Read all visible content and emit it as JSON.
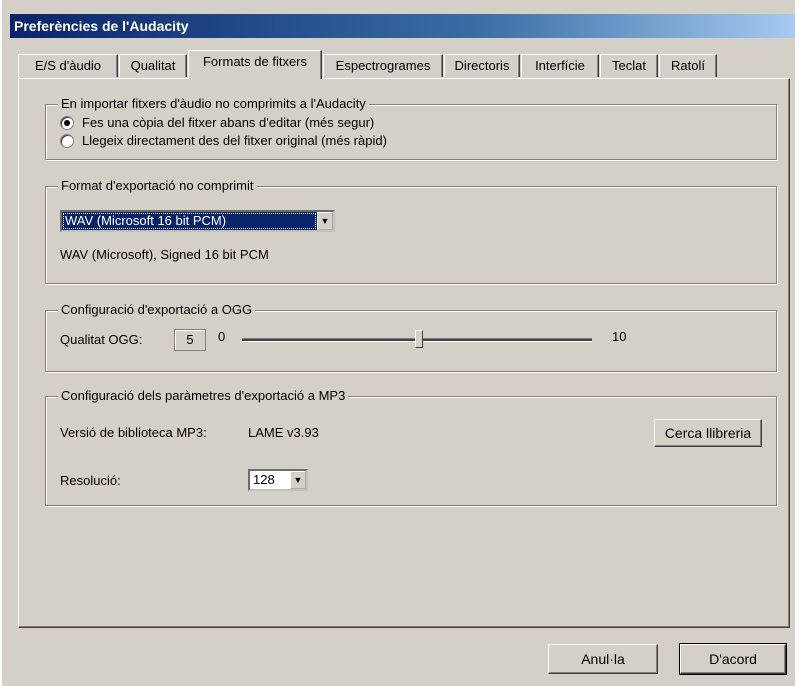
{
  "window": {
    "title": "Preferències de l'Audacity"
  },
  "tabs": [
    {
      "label": "E/S d'àudio"
    },
    {
      "label": "Qualitat"
    },
    {
      "label": "Formats de fitxers"
    },
    {
      "label": "Espectrogrames"
    },
    {
      "label": "Directoris"
    },
    {
      "label": "Interfície"
    },
    {
      "label": "Teclat"
    },
    {
      "label": "Ratolí"
    }
  ],
  "import_group": {
    "legend": "En importar fitxers d'àudio no comprimits a l'Audacity",
    "option_copy": "Fes una còpia del fitxer abans d'editar (més segur)",
    "option_direct": "Llegeix directament des del fitxer original (més ràpid)",
    "selected": "copy"
  },
  "export_group": {
    "legend": "Format d'exportació no comprimit",
    "format_value": "WAV (Microsoft 16 bit PCM)",
    "format_description": "WAV (Microsoft), Signed 16 bit PCM"
  },
  "ogg_group": {
    "legend": "Configuració d'exportació a OGG",
    "quality_label": "Qualitat OGG:",
    "quality_value": "5",
    "slider_min": "0",
    "slider_max": "10"
  },
  "mp3_group": {
    "legend": "Configuració dels paràmetres d'exportació a MP3",
    "version_label": "Versió de biblioteca MP3:",
    "version_value": "LAME v3.93",
    "find_library_button": "Cerca llibreria",
    "bitrate_label": "Resolució:",
    "bitrate_value": "128"
  },
  "footer": {
    "cancel_button": "Anul·la",
    "ok_button": "D'acord"
  }
}
